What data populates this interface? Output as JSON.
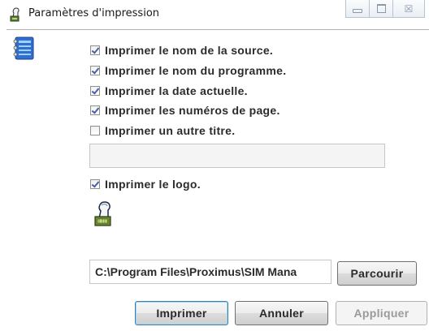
{
  "window": {
    "title": "Paramètres d'impression",
    "controls": {
      "minimize_icon": "minimize-icon",
      "maximize_icon": "maximize-icon",
      "close_glyph": "☒"
    }
  },
  "header_icon": "notebook-icon",
  "options": [
    {
      "label": "Imprimer le nom de la source.",
      "checked": true
    },
    {
      "label": "Imprimer le nom du programme.",
      "checked": true
    },
    {
      "label": "Imprimer la date actuelle.",
      "checked": true
    },
    {
      "label": "Imprimer les numéros de page.",
      "checked": true
    },
    {
      "label": "Imprimer un autre titre.",
      "checked": false
    }
  ],
  "alt_title": {
    "value": "",
    "placeholder": ""
  },
  "logo_option": {
    "label": "Imprimer le logo.",
    "checked": true,
    "icon": "logo-icon"
  },
  "logo_path": {
    "value": "C:\\Program Files\\Proximus\\SIM Mana"
  },
  "buttons": {
    "browse": "Parcourir",
    "print": "Imprimer",
    "cancel": "Annuler",
    "apply": "Appliquer"
  },
  "colors": {
    "check_mark": "#4a5fa8",
    "primary_border": "#3c7fb1",
    "disabled_text": "#9a9a9a"
  }
}
